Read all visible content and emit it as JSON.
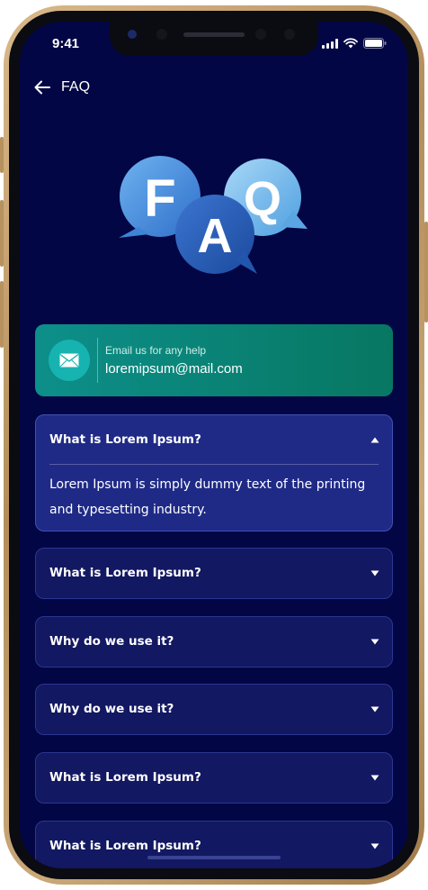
{
  "status_bar": {
    "time": "9:41"
  },
  "nav": {
    "title": "FAQ"
  },
  "hero": {
    "letters": [
      "F",
      "A",
      "Q"
    ]
  },
  "contact": {
    "label": "Email us for any help",
    "email": "loremipsum@mail.com"
  },
  "faq": [
    {
      "question": "What is Lorem Ipsum?",
      "answer": "Lorem Ipsum is simply dummy text of the printing and typesetting industry.",
      "expanded": true
    },
    {
      "question": "What is Lorem Ipsum?",
      "expanded": false
    },
    {
      "question": "Why do we use it?",
      "expanded": false
    },
    {
      "question": "Why do we use it?",
      "expanded": false
    },
    {
      "question": "What is Lorem Ipsum?",
      "expanded": false
    },
    {
      "question": "What is Lorem Ipsum?",
      "expanded": false
    }
  ],
  "colors": {
    "background": "#030644",
    "accent_teal": "#0d8f8a",
    "card_open": "#1f2a87",
    "card_closed": "#121861"
  },
  "icons": [
    "back-arrow-icon",
    "mail-icon",
    "chevron-up-icon",
    "chevron-down-icon",
    "signal-icon",
    "wifi-icon",
    "battery-icon"
  ]
}
